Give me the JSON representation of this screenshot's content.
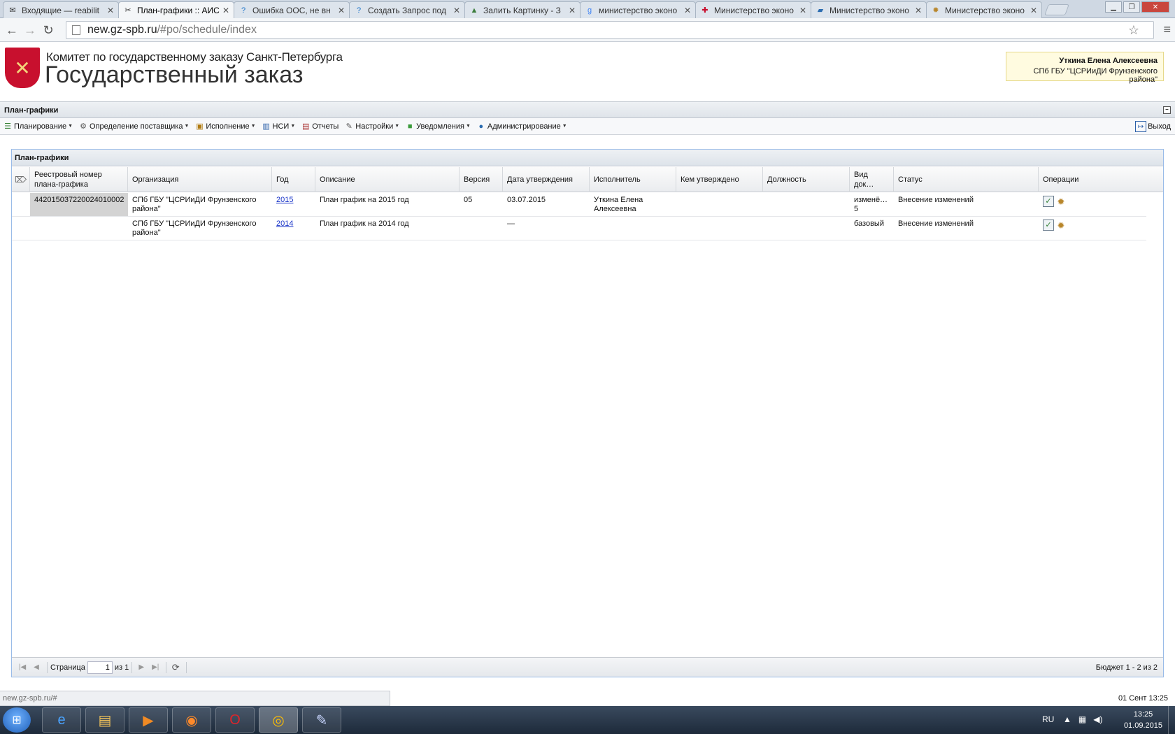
{
  "browser": {
    "tabs": [
      {
        "title": "Входящие — reabilit",
        "icon": "mail-icon",
        "glyph": "✉",
        "color": "#333"
      },
      {
        "title": "План-графики :: АИС",
        "icon": "tools-icon",
        "glyph": "✂",
        "color": "#333"
      },
      {
        "title": "Ошибка ООС, не вн",
        "icon": "help-icon",
        "glyph": "?",
        "color": "#1a73c9"
      },
      {
        "title": "Создать Запрос под",
        "icon": "help-icon",
        "glyph": "?",
        "color": "#1a73c9"
      },
      {
        "title": "Залить Картинку - З",
        "icon": "image-icon",
        "glyph": "▲",
        "color": "#3b7d3b"
      },
      {
        "title": "министерство эконо",
        "icon": "google-icon",
        "glyph": "g",
        "color": "#4285f4"
      },
      {
        "title": "Министерство эконо",
        "icon": "cross-icon",
        "glyph": "✚",
        "color": "#c8102e"
      },
      {
        "title": "Министерство эконо",
        "icon": "bookmark-icon",
        "glyph": "▰",
        "color": "#2b6cb0"
      },
      {
        "title": "Министерство эконо",
        "icon": "emblem-icon",
        "glyph": "✹",
        "color": "#b8862b"
      }
    ],
    "url_host": "new.gz-spb.ru",
    "url_path": "/#po/schedule/index"
  },
  "header": {
    "committee": "Комитет по государственному заказу Санкт-Петербурга",
    "title": "Государственный заказ",
    "user_name": "Уткина Елена Алексеевна",
    "user_org": "СПб ГБУ \"ЦСРИиДИ Фрунзенского района\""
  },
  "panel_title": "План-графики",
  "menu": [
    {
      "label": "Планирование",
      "icon": "list-icon",
      "glyph": "☰",
      "color": "#2f7d2f",
      "dropdown": true
    },
    {
      "label": "Определение поставщика",
      "icon": "gears-icon",
      "glyph": "⚙",
      "color": "#555",
      "dropdown": true
    },
    {
      "label": "Исполнение",
      "icon": "truck-icon",
      "glyph": "▣",
      "color": "#b07a10",
      "dropdown": true
    },
    {
      "label": "НСИ",
      "icon": "book-icon",
      "glyph": "▥",
      "color": "#2b5fa8",
      "dropdown": true
    },
    {
      "label": "Отчеты",
      "icon": "report-icon",
      "glyph": "▤",
      "color": "#a33",
      "dropdown": false
    },
    {
      "label": "Настройки",
      "icon": "wrench-icon",
      "glyph": "✎",
      "color": "#555",
      "dropdown": true
    },
    {
      "label": "Уведомления",
      "icon": "notification-icon",
      "glyph": "■",
      "color": "#3b9b3b",
      "dropdown": true
    },
    {
      "label": "Администрирование",
      "icon": "user-icon",
      "glyph": "●",
      "color": "#2b6cb0",
      "dropdown": true
    }
  ],
  "logout_label": "Выход",
  "grid": {
    "title": "План-графики",
    "columns": [
      "Реестровый номер плана-графика",
      "Организация",
      "Год",
      "Описание",
      "Версия",
      "Дата утверждения",
      "Исполнитель",
      "Кем утверждено",
      "Должность",
      "Вид док…",
      "Статус",
      "Операции"
    ],
    "rows": [
      {
        "reg_number": "442015037220024010002",
        "org": "СПб ГБУ \"ЦСРИиДИ Фрунзенского района\"",
        "year": "2015",
        "description": "План график на 2015 год",
        "version": "05",
        "approval_date": "03.07.2015",
        "executor": "Уткина Елена Алексеевна",
        "approved_by": "",
        "position": "",
        "doc_type": "изменё… 5",
        "status": "Внесение изменений"
      },
      {
        "reg_number": "",
        "org": "СПб ГБУ \"ЦСРИиДИ Фрунзенского района\"",
        "year": "2014",
        "description": "План график на 2014 год",
        "version": "",
        "approval_date": "—",
        "executor": "",
        "approved_by": "",
        "position": "",
        "doc_type": "базовый",
        "status": "Внесение изменений"
      }
    ]
  },
  "pager": {
    "page_label": "Страница",
    "page_value": "1",
    "of_label": "из 1",
    "info": "Бюджет 1 - 2 из 2"
  },
  "status": {
    "url": "new.gz-spb.ru/#",
    "datetime": "01 Сент 13:25"
  },
  "taskbar": {
    "lang": "RU",
    "time": "13:25",
    "date": "01.09.2015"
  }
}
